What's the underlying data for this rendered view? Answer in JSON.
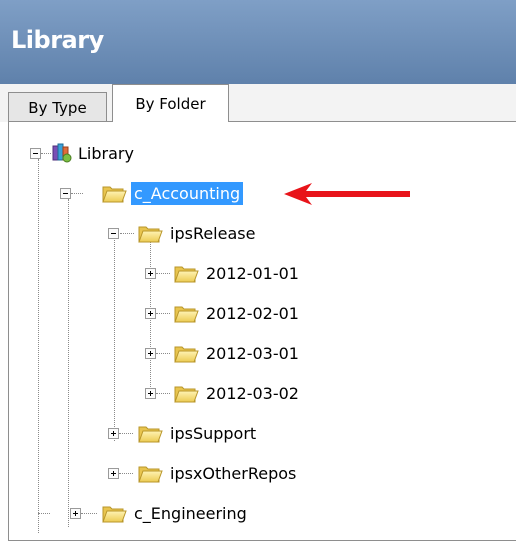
{
  "header": {
    "title": "Library"
  },
  "tabs": [
    {
      "label": "By Type",
      "active": false
    },
    {
      "label": "By Folder",
      "active": true
    }
  ],
  "tree": {
    "root": "Library",
    "items": [
      {
        "label": "c_Accounting",
        "selected": true,
        "expanded": true
      },
      {
        "label": "ipsRelease",
        "expanded": true
      },
      {
        "label": "2012-01-01",
        "expanded": false
      },
      {
        "label": "2012-02-01",
        "expanded": false
      },
      {
        "label": "2012-03-01",
        "expanded": false
      },
      {
        "label": "2012-03-02",
        "expanded": false
      },
      {
        "label": "ipsSupport",
        "expanded": false
      },
      {
        "label": "ipsxOtherRepos",
        "expanded": false
      },
      {
        "label": "c_Engineering",
        "expanded": false
      }
    ]
  },
  "colors": {
    "header": "#6a8cb8",
    "selection": "#3399ff",
    "folder": "#f2d66a",
    "annotation_arrow": "#e8141a"
  },
  "icons": [
    "library-icon",
    "folder-icon",
    "expand-icon",
    "collapse-icon",
    "red-arrow-icon"
  ]
}
